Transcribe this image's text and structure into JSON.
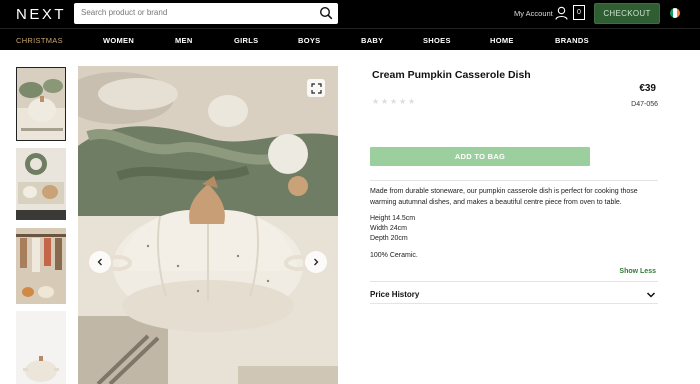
{
  "header": {
    "logo": "NEXT",
    "search_placeholder": "Search product or brand",
    "account_label": "My Account",
    "bag_count": "0",
    "checkout_label": "CHECKOUT"
  },
  "nav": {
    "items": [
      "CHRISTMAS",
      "WOMEN",
      "MEN",
      "GIRLS",
      "BOYS",
      "BABY",
      "SHOES",
      "HOME",
      "BRANDS"
    ]
  },
  "product": {
    "title": "Cream Pumpkin Casserole Dish",
    "price": "€39",
    "sku": "D47-056",
    "rating": 0,
    "add_to_bag_label": "ADD TO BAG",
    "description": "Made from durable stoneware, our pumpkin casserole dish is perfect for cooking those warming autumnal dishes, and makes a beautiful centre piece from oven to table.",
    "specs": [
      "Height 14.5cm",
      "Width 24cm",
      "Depth 20cm"
    ],
    "material": "100% Ceramic.",
    "show_less_label": "Show Less",
    "price_history_label": "Price History"
  },
  "colors": {
    "checkout_bg": "#2e5e32",
    "add_to_bag_bg": "#9ccf9e",
    "christmas_nav": "#c9a56b"
  }
}
